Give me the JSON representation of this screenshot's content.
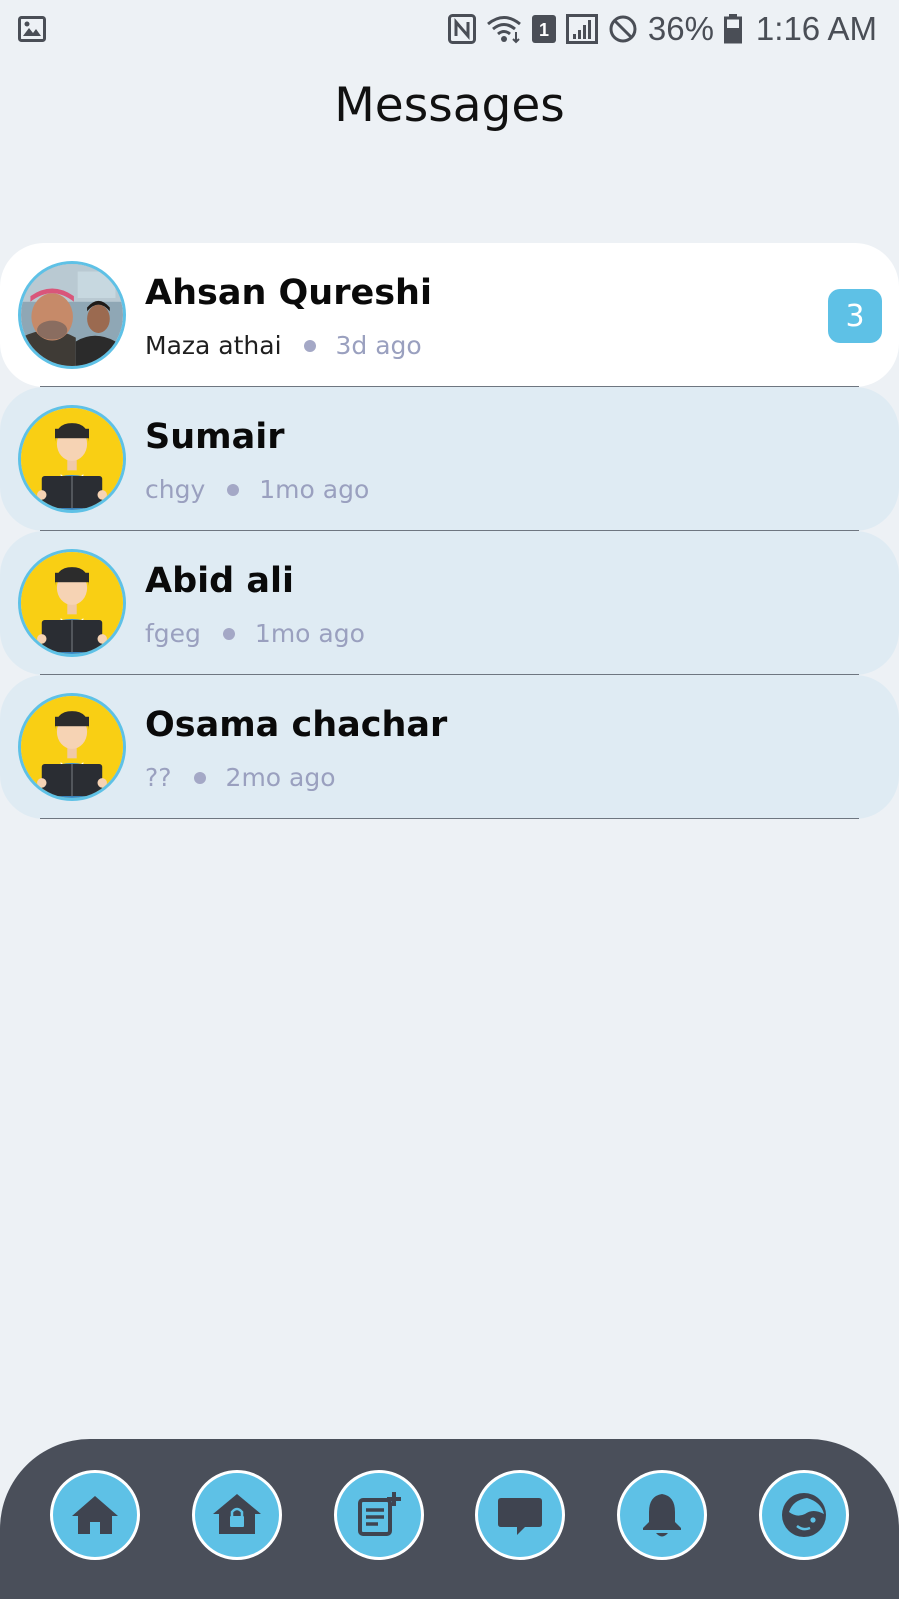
{
  "status_bar": {
    "battery": "36%",
    "time": "1:16 AM",
    "sim_slot": "1",
    "icons": [
      "image-icon",
      "nfc-icon",
      "wifi-icon",
      "sim-icon",
      "signal-icon",
      "do-not-disturb-icon",
      "battery-icon"
    ]
  },
  "header": {
    "title": "Messages"
  },
  "conversations": [
    {
      "name": "Ahsan Qureshi",
      "last_message": "Maza athai",
      "time": "3d ago",
      "unread": "3",
      "avatar": "photo-avatar",
      "active": true
    },
    {
      "name": "Sumair",
      "last_message": "chgy",
      "time": "1mo ago",
      "avatar": "reading-boy-avatar"
    },
    {
      "name": "Abid ali",
      "last_message": "fgeg",
      "time": "1mo ago",
      "avatar": "reading-boy-avatar"
    },
    {
      "name": "Osama chachar",
      "last_message": "??",
      "time": "2mo ago",
      "avatar": "reading-boy-avatar"
    }
  ],
  "bottom_nav": {
    "items": [
      "home-icon",
      "locked-home-icon",
      "new-post-icon",
      "chat-icon",
      "bell-icon",
      "profile-icon"
    ]
  },
  "colors": {
    "accent": "#5ec1e6",
    "background": "#edf1f5",
    "row_background": "#dfebf3",
    "nav_background": "#4a4f5a",
    "meta_text": "#9aa0bf"
  }
}
